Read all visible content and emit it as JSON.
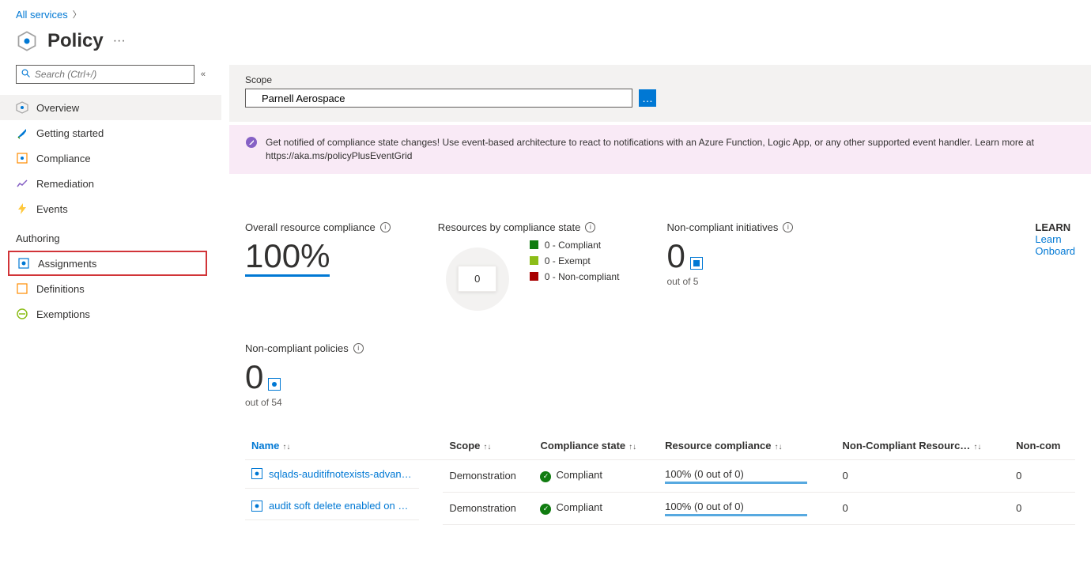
{
  "breadcrumb": {
    "all_services": "All services"
  },
  "page": {
    "title": "Policy"
  },
  "search": {
    "placeholder": "Search (Ctrl+/)"
  },
  "nav": {
    "items": [
      {
        "label": "Overview",
        "icon": "overview-icon"
      },
      {
        "label": "Getting started",
        "icon": "rocket-icon"
      },
      {
        "label": "Compliance",
        "icon": "compliance-icon"
      },
      {
        "label": "Remediation",
        "icon": "remediation-icon"
      },
      {
        "label": "Events",
        "icon": "lightning-icon"
      }
    ],
    "section_authoring": "Authoring",
    "authoring_items": [
      {
        "label": "Assignments",
        "icon": "assignments-icon"
      },
      {
        "label": "Definitions",
        "icon": "definitions-icon"
      },
      {
        "label": "Exemptions",
        "icon": "exemptions-icon"
      }
    ]
  },
  "scope": {
    "label": "Scope",
    "value": "Parnell Aerospace"
  },
  "notification": {
    "text": "Get notified of compliance state changes! Use event-based architecture to react to notifications with an Azure Function, Logic App, or any other supported event handler. Learn more at https://aka.ms/policyPlusEventGrid"
  },
  "cards": {
    "overall": {
      "title": "Overall resource compliance",
      "value": "100%"
    },
    "by_state": {
      "title": "Resources by compliance state",
      "center": "0",
      "legend": [
        {
          "label": "0 - Compliant",
          "color": "#107c10"
        },
        {
          "label": "0 - Exempt",
          "color": "#8cbd18"
        },
        {
          "label": "0 - Non-compliant",
          "color": "#a80000"
        }
      ]
    },
    "initiatives": {
      "title": "Non-compliant initiatives",
      "value": "0",
      "sub": "out of 5"
    },
    "learn": {
      "title": "LEARN",
      "link1": "Learn",
      "link2": "Onboard"
    },
    "policies": {
      "title": "Non-compliant policies",
      "value": "0",
      "sub": "out of 54"
    }
  },
  "table": {
    "headers": [
      "Name",
      "Scope",
      "Compliance state",
      "Resource compliance",
      "Non-Compliant Resourc…",
      "Non-com"
    ],
    "rows": [
      {
        "name": "sqlads-auditifnotexists-advan…",
        "scope": "Demonstration",
        "state": "Compliant",
        "resource": "100% (0 out of 0)",
        "ncr": "0",
        "ncp": "0"
      },
      {
        "name": "audit soft delete enabled on …",
        "scope": "Demonstration",
        "state": "Compliant",
        "resource": "100% (0 out of 0)",
        "ncr": "0",
        "ncp": "0"
      }
    ]
  }
}
